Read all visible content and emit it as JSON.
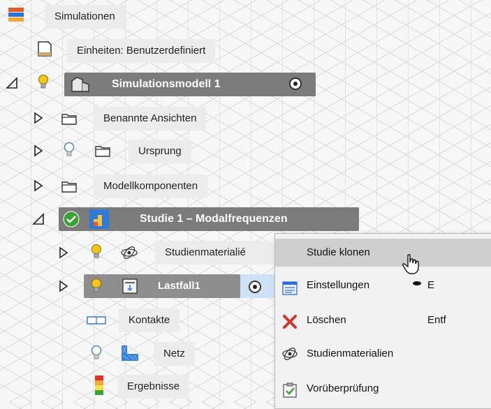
{
  "tree": {
    "root_label": "Simulationen",
    "units_label": "Einheiten: Benutzerdefiniert",
    "model_label": "Simulationsmodell 1",
    "named_views_label": "Benannte Ansichten",
    "origin_label": "Ursprung",
    "components_label": "Modellkomponenten",
    "study_label": "Studie 1 – Modalfrequenzen",
    "study_materials_label": "Studienmaterialié",
    "loadcase_label": "Lastfall1",
    "contacts_label": "Kontakte",
    "mesh_label": "Netz",
    "results_label": "Ergebnisse"
  },
  "context_menu": {
    "items": [
      {
        "label": "Studie klonen",
        "shortcut": "",
        "icon": "none"
      },
      {
        "label": "Einstellungen",
        "shortcut": "E",
        "icon": "settings-icon"
      },
      {
        "label": "Löschen",
        "shortcut": "Entf",
        "icon": "delete-x-icon"
      },
      {
        "label": "Studienmaterialien",
        "shortcut": "",
        "icon": "materials-icon"
      },
      {
        "label": "Vorüberprüfung",
        "shortcut": "",
        "icon": "precheck-icon"
      }
    ]
  },
  "colors": {
    "selected_dark": "#7b7b7b",
    "study_ok_green": "#3aa335",
    "delete_red": "#d9302c",
    "bulb_yellow": "#f5c518",
    "bulb_blue": "#7fb0e0"
  }
}
